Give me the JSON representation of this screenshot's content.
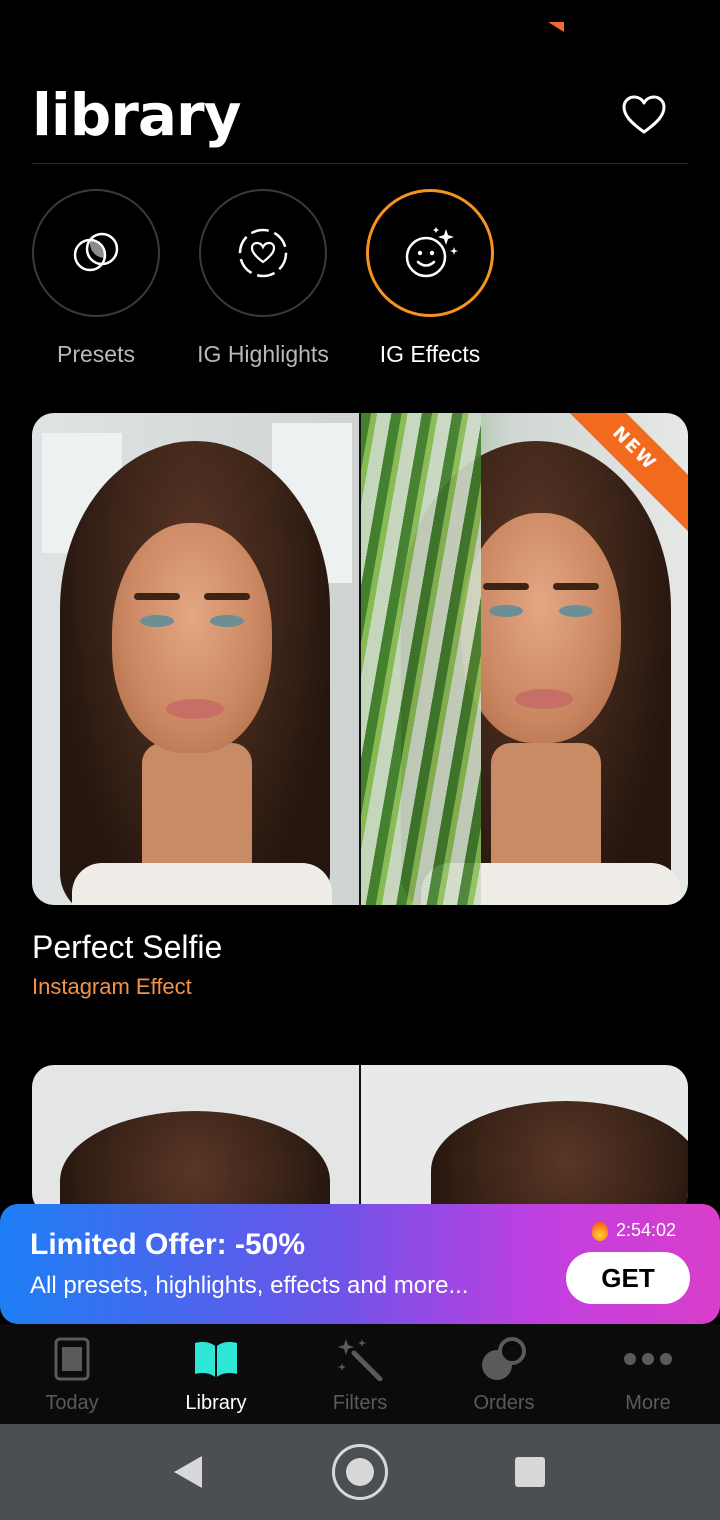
{
  "header": {
    "title": "library"
  },
  "categories": [
    {
      "label": "Presets",
      "icon": "presets-icon",
      "active": false
    },
    {
      "label": "IG Highlights",
      "icon": "highlight-heart-icon",
      "active": false
    },
    {
      "label": "IG Effects",
      "icon": "smiley-sparkle-icon",
      "active": true
    }
  ],
  "cards": [
    {
      "title": "Perfect Selfie",
      "subtitle": "Instagram Effect",
      "badge": "NEW"
    }
  ],
  "offer": {
    "title": "Limited Offer: -50%",
    "text": "All presets, highlights, effects and more...",
    "timer": "2:54:02",
    "button": "GET"
  },
  "tabs": [
    {
      "label": "Today",
      "icon": "today-icon",
      "active": false
    },
    {
      "label": "Library",
      "icon": "library-book-icon",
      "active": true
    },
    {
      "label": "Filters",
      "icon": "magic-wand-icon",
      "active": false
    },
    {
      "label": "Orders",
      "icon": "orders-icon",
      "active": false
    },
    {
      "label": "More",
      "icon": "more-dots-icon",
      "active": false
    }
  ],
  "colors": {
    "accent": "#f7931e",
    "badge": "#f26a1e",
    "active_tab": "#2ee6d6",
    "subtitle": "#f3934a"
  }
}
